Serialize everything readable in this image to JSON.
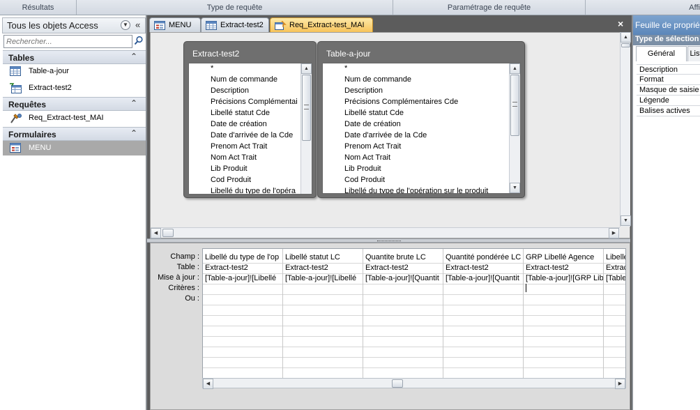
{
  "ribbon": {
    "groups": [
      "Résultats",
      "Type de requête",
      "Paramétrage de requête",
      "Affi"
    ]
  },
  "nav": {
    "title": "Tous les objets Access",
    "search_placeholder": "Rechercher...",
    "sections": [
      {
        "label": "Tables",
        "items": [
          {
            "label": "Table-a-jour",
            "icon": "table-icon"
          },
          {
            "label": "Extract-test2",
            "icon": "linked-table-icon"
          }
        ]
      },
      {
        "label": "Requêtes",
        "items": [
          {
            "label": "Req_Extract-test_MAI",
            "icon": "update-query-icon"
          }
        ]
      },
      {
        "label": "Formulaires",
        "items": [
          {
            "label": "MENU",
            "icon": "form-icon",
            "selected": true
          }
        ]
      }
    ]
  },
  "tabs": [
    {
      "label": "MENU",
      "icon": "form-icon"
    },
    {
      "label": "Extract-test2",
      "icon": "table-icon"
    },
    {
      "label": "Req_Extract-test_MAI",
      "icon": "update-query-icon",
      "active": true
    }
  ],
  "tables": [
    {
      "title": "Extract-test2",
      "fields": [
        "*",
        "Num de commande",
        "Description",
        "Précisions Complémentai",
        "Libellé statut Cde",
        "Date de création",
        "Date d'arrivée de la Cde",
        "Prenom Act Trait",
        "Nom Act Trait",
        "Lib Produit",
        "Cod Produit",
        "Libellé du type de l'opéra"
      ]
    },
    {
      "title": "Table-a-jour",
      "fields": [
        "*",
        "Num de commande",
        "Description",
        "Précisions Complémentaires Cde",
        "Libellé statut Cde",
        "Date de création",
        "Date d'arrivée de la Cde",
        "Prenom Act Trait",
        "Nom Act Trait",
        "Lib Produit",
        "Cod Produit",
        "Libellé du type de l'opération sur le produit"
      ]
    }
  ],
  "grid": {
    "row_labels": [
      "Champ :",
      "Table :",
      "Mise à jour :",
      "Critères :",
      "Ou :"
    ],
    "columns": [
      {
        "champ": "Libellé du type de l'op",
        "table": "Extract-test2",
        "maj": "[Table-a-jour]![Libellé"
      },
      {
        "champ": "Libellé statut LC",
        "table": "Extract-test2",
        "maj": "[Table-a-jour]![Libellé"
      },
      {
        "champ": "Quantite brute LC",
        "table": "Extract-test2",
        "maj": "[Table-a-jour]![Quantit"
      },
      {
        "champ": "Quantité pondérée LC",
        "table": "Extract-test2",
        "maj": "[Table-a-jour]![Quantit"
      },
      {
        "champ": "GRP Libellé Agence",
        "table": "Extract-test2",
        "maj": "[Table-a-jour]![GRP Lib"
      },
      {
        "champ": "Libelle",
        "table": "Extrac",
        "maj": "[Table"
      }
    ]
  },
  "props": {
    "title": "Feuille de propriét",
    "type_label": "Type de sélection :",
    "tabs": [
      "Général",
      "List"
    ],
    "rows": [
      "Description",
      "Format",
      "Masque de saisie",
      "Légende",
      "Balises actives"
    ]
  }
}
